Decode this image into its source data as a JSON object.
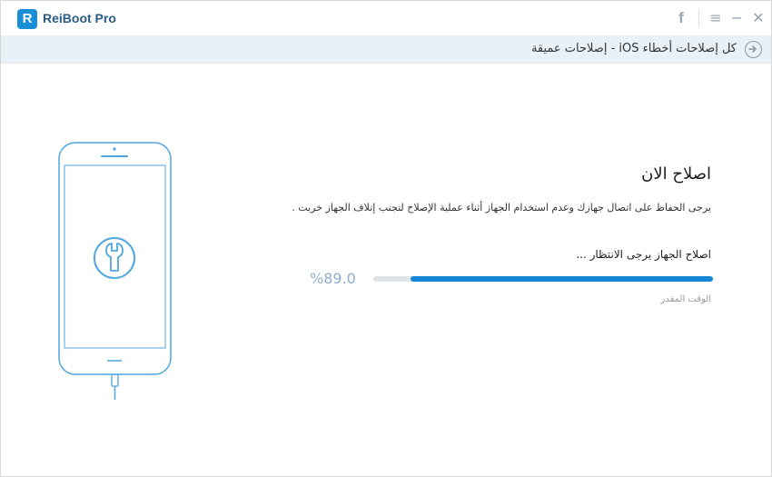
{
  "app": {
    "title": "ReiBoot Pro",
    "logo_letter": "R"
  },
  "titlebar": {
    "facebook_glyph": "f",
    "menu_glyph": "≡",
    "minimize_glyph": "−",
    "close_glyph": "✕"
  },
  "breadcrumb": {
    "text": "كل إصلاحات أخطاء iOS - إصلاحات عميقة"
  },
  "repair": {
    "heading": "اصلاح الان",
    "description": "يرجى الحفاظ على اتصال جهازك وعدم استخدام الجهاز أثناء عملية الإصلاح لتجنب إتلاف الجهاز خربت .",
    "progress_label": "اصلاح الجهاز يرجى الانتظار ...",
    "progress_percent_text": "%89.0",
    "progress_value": 0.89,
    "time_label": "الوقت المقدر"
  },
  "colors": {
    "accent": "#1686d4",
    "brand_text": "#2a5d86",
    "breadcrumb_bg": "#e8f1f7",
    "phone_outline": "#4ea6df"
  },
  "icons": {
    "back": "arrow-right-circle-icon",
    "facebook": "facebook-icon",
    "menu": "menu-icon",
    "minimize": "minimize-icon",
    "close": "close-icon",
    "wrench": "wrench-icon"
  }
}
